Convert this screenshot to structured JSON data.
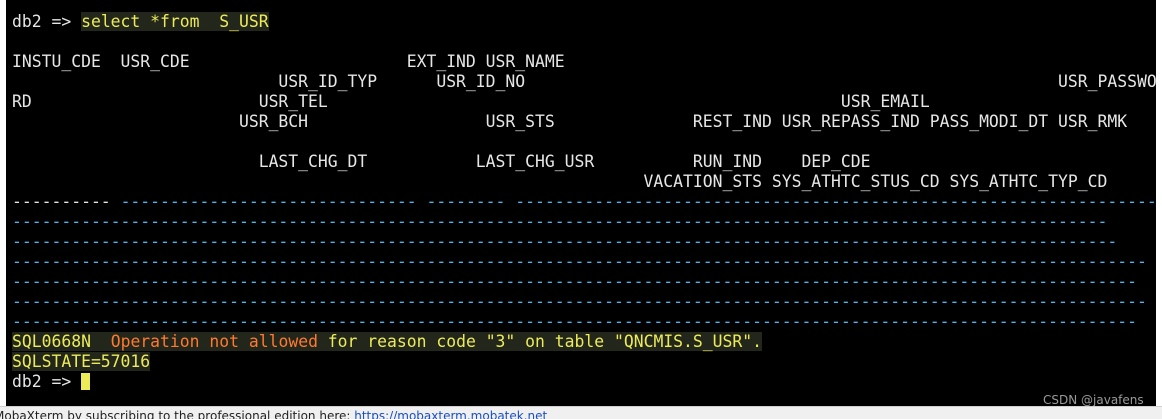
{
  "terminal": {
    "prompt1": "db2 => ",
    "command": "select *from  S_USR",
    "header_lines": [
      "INSTU_CDE  USR_CDE                      EXT_IND USR_NAME",
      "                           USR_ID_TYP      USR_ID_NO                                                      USR_PASSWO",
      "RD                       USR_TEL                                                    USR_EMAIL",
      "                       USR_BCH                  USR_STS              REST_IND USR_REPASS_IND PASS_MODI_DT USR_RMK",
      "",
      "                         LAST_CHG_DT           LAST_CHG_USR          RUN_IND    DEP_CDE",
      "                                                                VACATION_STS SYS_ATHTC_STUS_CD SYS_ATHTC_TYP_CD"
    ],
    "separator_first": "---------- ",
    "separator_lines": [
      "------------------------------ -------- ---------------------------------------------------------------------",
      "---------------------------------------------------------------------------------------------------------------",
      "----------------------------------------------------------------------------------------------------------------",
      "-------------------------------------------------------------------------------------------------------------------",
      "------------------------------------------------------------------------------------------------------------------",
      "-------------------------------------------------------------------------------------------------------------------",
      "------------------------------------------------------------------------------------------------------------------",
      "------------------------------------------------------------------------------------------------------------"
    ],
    "error_code": "SQL0668N",
    "error_gap": "  ",
    "error_highlight": "Operation not allowed",
    "error_rest": " for reason code \"3\" on table \"QNCMIS.S_USR\".",
    "sqlstate": "SQLSTATE=57016",
    "prompt2": "db2 => "
  },
  "statusbar": {
    "text": "MobaXterm by subscribing to the professional edition here: ",
    "link": "https://mobaxterm.mobatek.net"
  },
  "watermark": "CSDN @javafens",
  "colors": {
    "terminal_bg": "#000000",
    "text": "#e6e6e6",
    "highlight_yellow": "#ecec58",
    "highlight_orange": "#ff7a2e",
    "separator_blue": "#4bb6f0"
  }
}
